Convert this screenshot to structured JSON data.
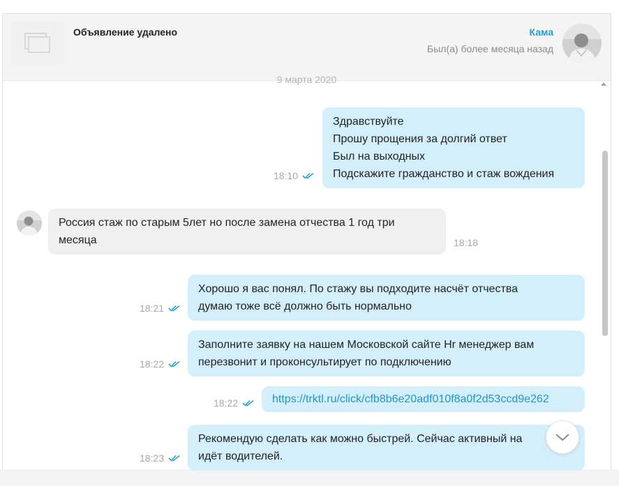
{
  "header": {
    "ad_title": "Объявление удалено",
    "user_name": "Кама",
    "user_status": "Был(а) более месяца назад"
  },
  "chat": {
    "date_separator": "9 марта 2020",
    "messages": [
      {
        "direction": "outgoing",
        "lines": [
          "Здравствуйте",
          "Прошу прощения за долгий ответ",
          "Был на выходных",
          "Подскажите гражданство и стаж вождения"
        ],
        "time": "18:10",
        "read": true
      },
      {
        "direction": "incoming",
        "lines": [
          "Россия стаж по старым 5лет но после замена отчества 1 год три",
          "месяца"
        ],
        "time": "18:18"
      },
      {
        "direction": "outgoing",
        "lines": [
          "Хорошо я вас понял. По стажу вы подходите насчёт отчества",
          "думаю тоже всё должно быть нормально"
        ],
        "time": "18:21",
        "read": true
      },
      {
        "direction": "outgoing",
        "lines": [
          "Заполните заявку на нашем Московской сайте Hr менеджер вам",
          "перезвонит и проконсультирует по подключению"
        ],
        "time": "18:22",
        "read": true
      },
      {
        "direction": "outgoing",
        "link": "https://trktl.ru/click/cfb8b6e20adf010f8a0f2d53ccd9e262",
        "time": "18:22",
        "read": true
      },
      {
        "direction": "outgoing",
        "lines": [
          "Рекомендую сделать как можно быстрей. Сейчас активный на",
          "идёт водителей."
        ],
        "time": "18:23",
        "read": true
      }
    ]
  },
  "icons": {
    "ad_placeholder": "image-placeholder-icon",
    "read_receipt": "double-check-icon",
    "scroll_down": "chevron-down-icon"
  },
  "colors": {
    "accent": "#1ea0d6",
    "outgoing_bubble": "#d4effc",
    "incoming_bubble": "#f0f0f0",
    "read_check": "#1ea0d6"
  }
}
